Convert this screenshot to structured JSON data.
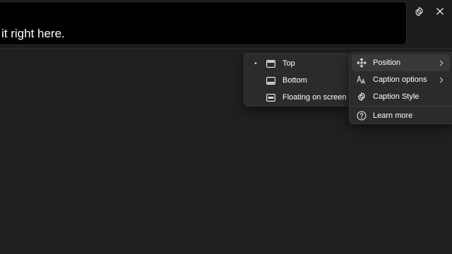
{
  "caption": {
    "text": "it right here."
  },
  "controls": {
    "settings_icon": "gear-icon",
    "close_icon": "close-icon"
  },
  "main_menu": {
    "items": [
      {
        "label": "Position",
        "icon": "move-arrows-icon",
        "has_submenu": true
      },
      {
        "label": "Caption options",
        "icon": "font-size-icon",
        "has_submenu": true
      },
      {
        "label": "Caption Style",
        "icon": "gear-icon",
        "has_submenu": false
      },
      {
        "label": "Learn more",
        "icon": "help-circle-icon",
        "has_submenu": false
      }
    ]
  },
  "position_submenu": {
    "selected": "Top",
    "items": [
      {
        "label": "Top",
        "icon": "window-top-icon"
      },
      {
        "label": "Bottom",
        "icon": "window-bottom-icon"
      },
      {
        "label": "Floating on screen",
        "icon": "window-floating-icon"
      }
    ]
  },
  "colors": {
    "background": "#202020",
    "caption_box": "#000000",
    "menu_background": "#2b2b2b",
    "menu_active": "#383838",
    "text": "#ffffff"
  }
}
